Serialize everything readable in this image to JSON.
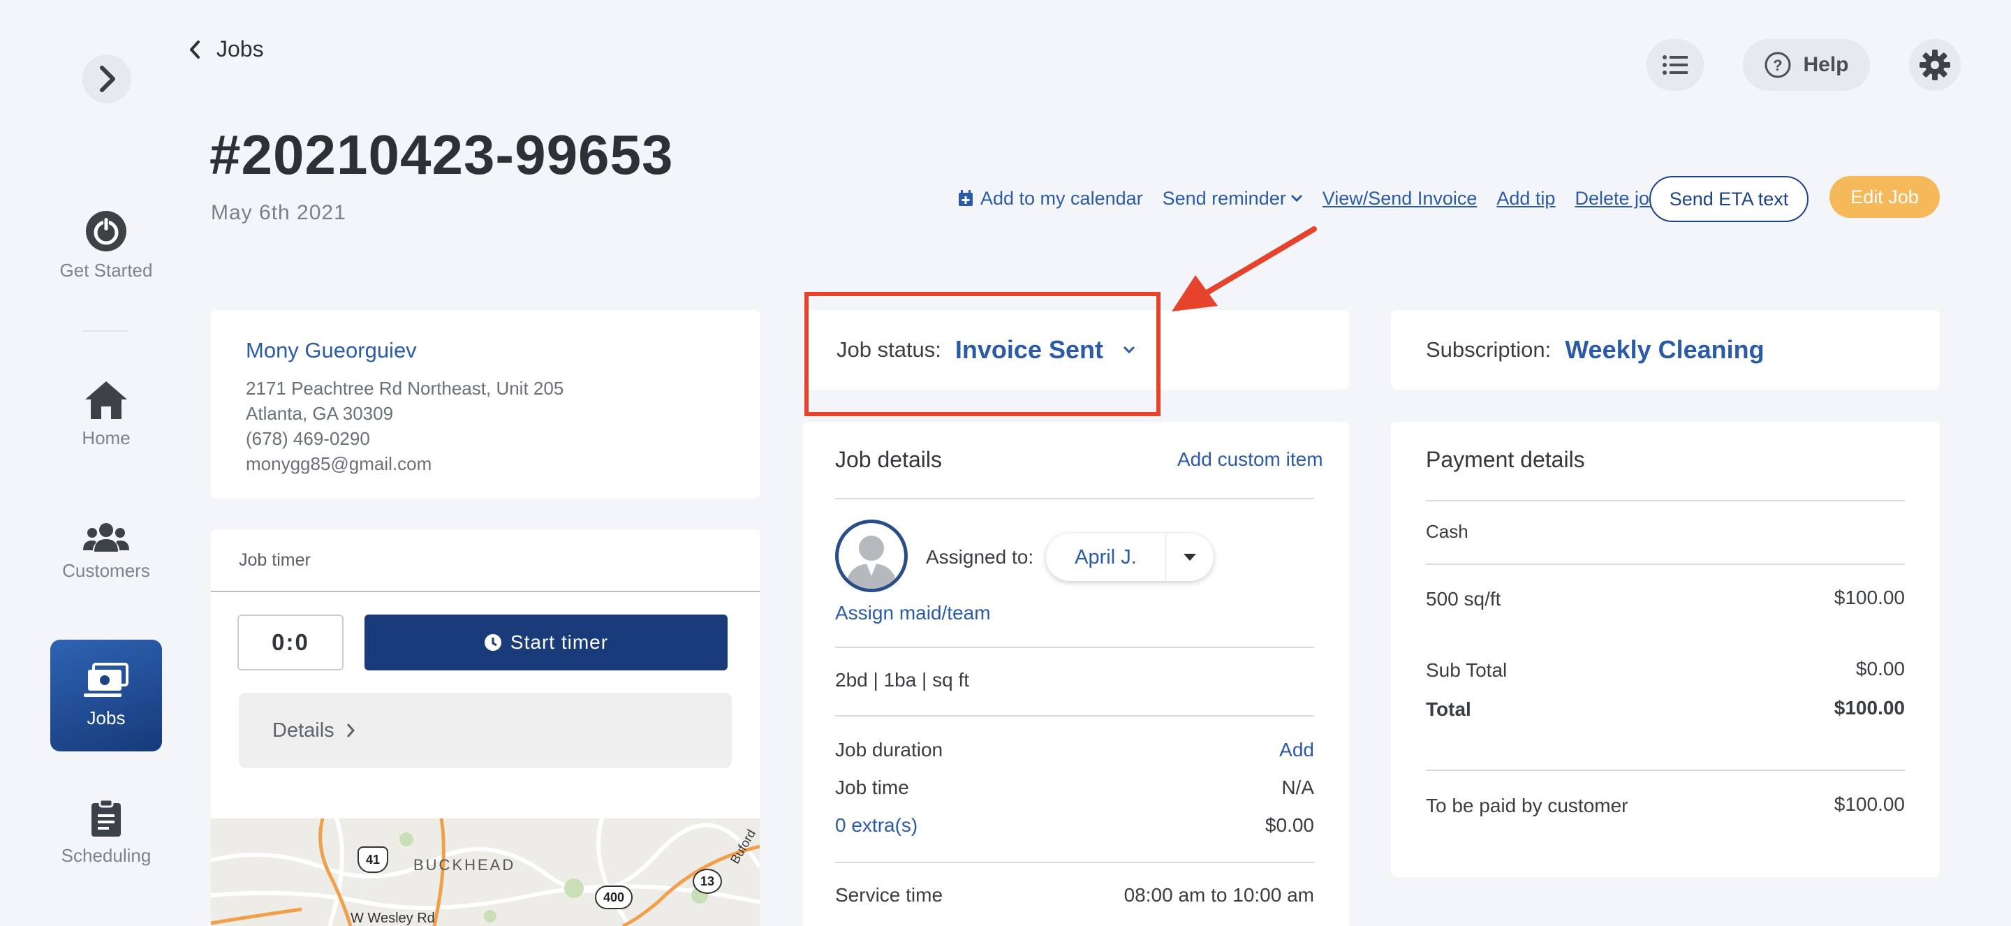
{
  "sidebar": {
    "items": [
      {
        "label": "Get Started",
        "icon": "power-icon"
      },
      {
        "label": "Home",
        "icon": "home-icon"
      },
      {
        "label": "Customers",
        "icon": "users-icon"
      },
      {
        "label": "Jobs",
        "icon": "jobs-icon",
        "active": true
      },
      {
        "label": "Scheduling",
        "icon": "clipboard-icon"
      }
    ]
  },
  "header": {
    "back_label": "Jobs",
    "help_label": "Help",
    "job_number": "#20210423-99653",
    "job_date": "May 6th 2021"
  },
  "actions": {
    "add_calendar": "Add to my calendar",
    "send_reminder": "Send reminder",
    "view_invoice": "View/Send Invoice",
    "add_tip": "Add tip",
    "delete_job": "Delete job",
    "send_eta": "Send ETA text",
    "edit_job": "Edit Job"
  },
  "customer": {
    "name": "Mony Gueorguiev",
    "address1": "2171 Peachtree Rd Northeast, Unit 205",
    "address2": "Atlanta, GA 30309",
    "phone": "(678) 469-0290",
    "email": "monygg85@gmail.com"
  },
  "timer": {
    "title": "Job timer",
    "value": "0:0",
    "start_label": "Start timer",
    "details_label": "Details"
  },
  "map": {
    "area_label": "BUCKHEAD",
    "road1": "41",
    "road2": "400",
    "road3": "13",
    "street": "W Wesley Rd",
    "street2": "Buford"
  },
  "status": {
    "label": "Job status:",
    "value": "Invoice Sent"
  },
  "job_details": {
    "title": "Job details",
    "add_custom": "Add custom item",
    "assigned_label": "Assigned to:",
    "assignee": "April J.",
    "assign_link": "Assign maid/team",
    "home_info": "2bd | 1ba | sq ft",
    "duration_label": "Job duration",
    "duration_action": "Add",
    "time_label": "Job time",
    "time_value": "N/A",
    "extras_label": "0 extra(s)",
    "extras_value": "$0.00",
    "service_label": "Service time",
    "service_value": "08:00 am to 10:00 am"
  },
  "subscription": {
    "label": "Subscription:",
    "value": "Weekly Cleaning"
  },
  "payment": {
    "title": "Payment details",
    "method": "Cash",
    "line_label": "500 sq/ft",
    "line_value": "$100.00",
    "subtotal_label": "Sub Total",
    "subtotal_value": "$0.00",
    "total_label": "Total",
    "total_value": "$100.00",
    "due_label": "To be paid by customer",
    "due_value": "$100.00"
  },
  "colors": {
    "brand_blue": "#2b5ba6",
    "navy": "#1a3b7a",
    "accent_orange": "#f5b95a",
    "annotation_red": "#e5432c"
  }
}
